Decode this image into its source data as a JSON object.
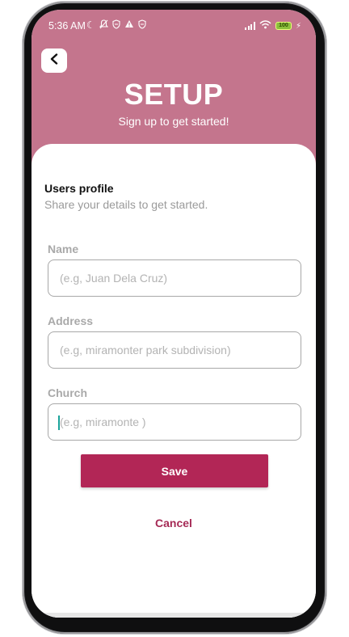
{
  "status_bar": {
    "time": "5:36 AM",
    "left_icons": [
      "moon-icon",
      "bell-off-icon",
      "shield-icon",
      "warning-icon",
      "shield-icon"
    ],
    "battery": "100"
  },
  "header": {
    "title": "SETUP",
    "subtitle": "Sign up to get started!"
  },
  "profile": {
    "title": "Users profile",
    "subtitle": "Share your details to get started."
  },
  "fields": {
    "name": {
      "label": "Name",
      "placeholder": "(e.g, Juan Dela Cruz)",
      "value": ""
    },
    "address": {
      "label": "Address",
      "placeholder": "(e.g, miramonter park subdivision)",
      "value": ""
    },
    "church": {
      "label": "Church",
      "placeholder": "(e.g, miramonte )",
      "value": ""
    }
  },
  "actions": {
    "save_label": "Save",
    "cancel_label": "Cancel"
  },
  "colors": {
    "header_bg": "#c4758d",
    "primary": "#b22656",
    "cancel_text": "#a52a55",
    "caret": "#1aa39a"
  }
}
